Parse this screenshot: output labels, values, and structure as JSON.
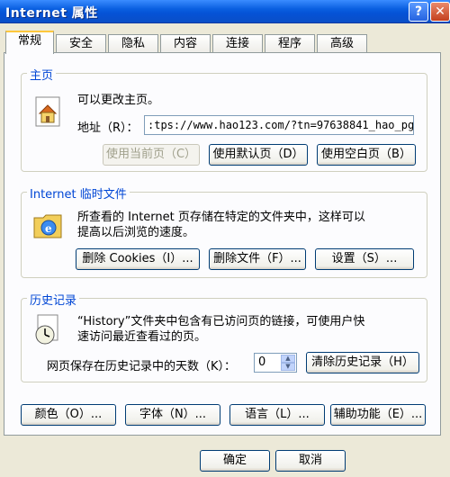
{
  "window": {
    "title": "Internet 属性",
    "help_glyph": "?",
    "close_glyph": "✕"
  },
  "tabs": [
    {
      "label": "常规",
      "active": true
    },
    {
      "label": "安全"
    },
    {
      "label": "隐私"
    },
    {
      "label": "内容"
    },
    {
      "label": "连接"
    },
    {
      "label": "程序"
    },
    {
      "label": "高级"
    }
  ],
  "home": {
    "group_title": "主页",
    "description": "可以更改主页。",
    "address_label": "地址（R）：",
    "address_value": ":tps://www.hao123.com/?tn=97638841_hao_pg",
    "use_current": "使用当前页（C）",
    "use_default": "使用默认页（D）",
    "use_blank": "使用空白页（B）"
  },
  "temp": {
    "group_title": "Internet 临时文件",
    "description_line1": "所查看的 Internet 页存储在特定的文件夹中，这样可以",
    "description_line2": "提高以后浏览的速度。",
    "delete_cookies": "删除 Cookies（I）...",
    "delete_files": "删除文件（F）...",
    "settings": "设置（S）..."
  },
  "history": {
    "group_title": "历史记录",
    "description_line1": "“History”文件夹中包含有已访问页的链接，可使用户快",
    "description_line2": "速访问最近查看过的页。",
    "days_label": "网页保存在历史记录中的天数（K）：",
    "days_value": "0",
    "clear": "清除历史记录（H）"
  },
  "bottom_buttons": {
    "colors": "颜色（O）...",
    "fonts": "字体（N）...",
    "languages": "语言（L）...",
    "accessibility": "辅助功能（E）..."
  },
  "dialog": {
    "ok": "确定",
    "cancel": "取消"
  }
}
